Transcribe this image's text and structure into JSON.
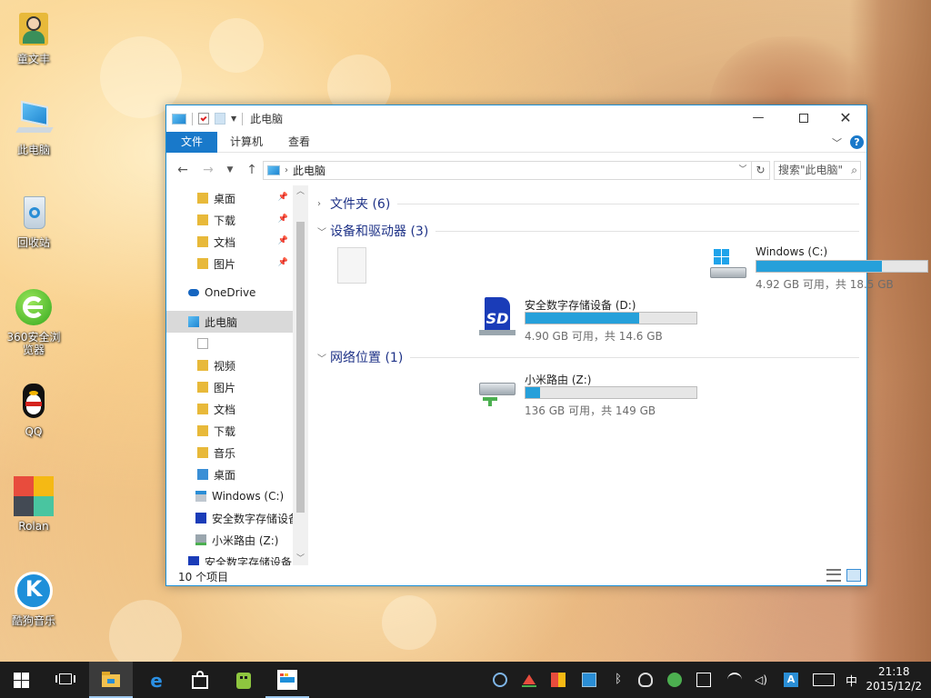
{
  "desktop": {
    "icons": [
      {
        "label": "童文丰"
      },
      {
        "label": "此电脑"
      },
      {
        "label": "回收站"
      },
      {
        "label": "360安全浏览器"
      },
      {
        "label": "QQ"
      },
      {
        "label": "Rolan"
      },
      {
        "label": "酷狗音乐"
      }
    ]
  },
  "window": {
    "title": "此电脑",
    "ribbon_tabs": [
      "文件",
      "计算机",
      "查看"
    ],
    "address": "此电脑",
    "search_placeholder": "搜索\"此电脑\"",
    "nav_items": [
      {
        "label": "桌面",
        "pinned": true
      },
      {
        "label": "下载",
        "pinned": true
      },
      {
        "label": "文档",
        "pinned": true
      },
      {
        "label": "图片",
        "pinned": true
      },
      {
        "label": "OneDrive"
      },
      {
        "label": "此电脑"
      },
      {
        "label": ""
      },
      {
        "label": "视频"
      },
      {
        "label": "图片"
      },
      {
        "label": "文档"
      },
      {
        "label": "下载"
      },
      {
        "label": "音乐"
      },
      {
        "label": "桌面"
      },
      {
        "label": "Windows (C:)"
      },
      {
        "label": "安全数字存储设备"
      },
      {
        "label": "小米路由 (Z:)"
      },
      {
        "label": "安全数字存储设备"
      }
    ],
    "groups": [
      {
        "label": "文件夹 (6)",
        "expanded": false
      },
      {
        "label": "设备和驱动器 (3)",
        "expanded": true
      },
      {
        "label": "网络位置 (1)",
        "expanded": true
      }
    ],
    "drives": [
      {
        "name": "Windows (C:)",
        "free": "4.92 GB 可用，共 18.5 GB",
        "used_fraction": 0.734
      },
      {
        "name": "安全数字存储设备 (D:)",
        "free": "4.90 GB 可用，共 14.6 GB",
        "used_fraction": 0.664
      },
      {
        "name": "小米路由 (Z:)",
        "free": "136 GB 可用，共 149 GB",
        "used_fraction": 0.087
      }
    ],
    "status": "10 个项目"
  },
  "taskbar": {
    "ime": "中",
    "time": "21:18",
    "date": "2015/12/2"
  },
  "colors": {
    "accent": "#1979ca",
    "bar_fill": "#26a0da",
    "group_text": "#1e3287"
  }
}
